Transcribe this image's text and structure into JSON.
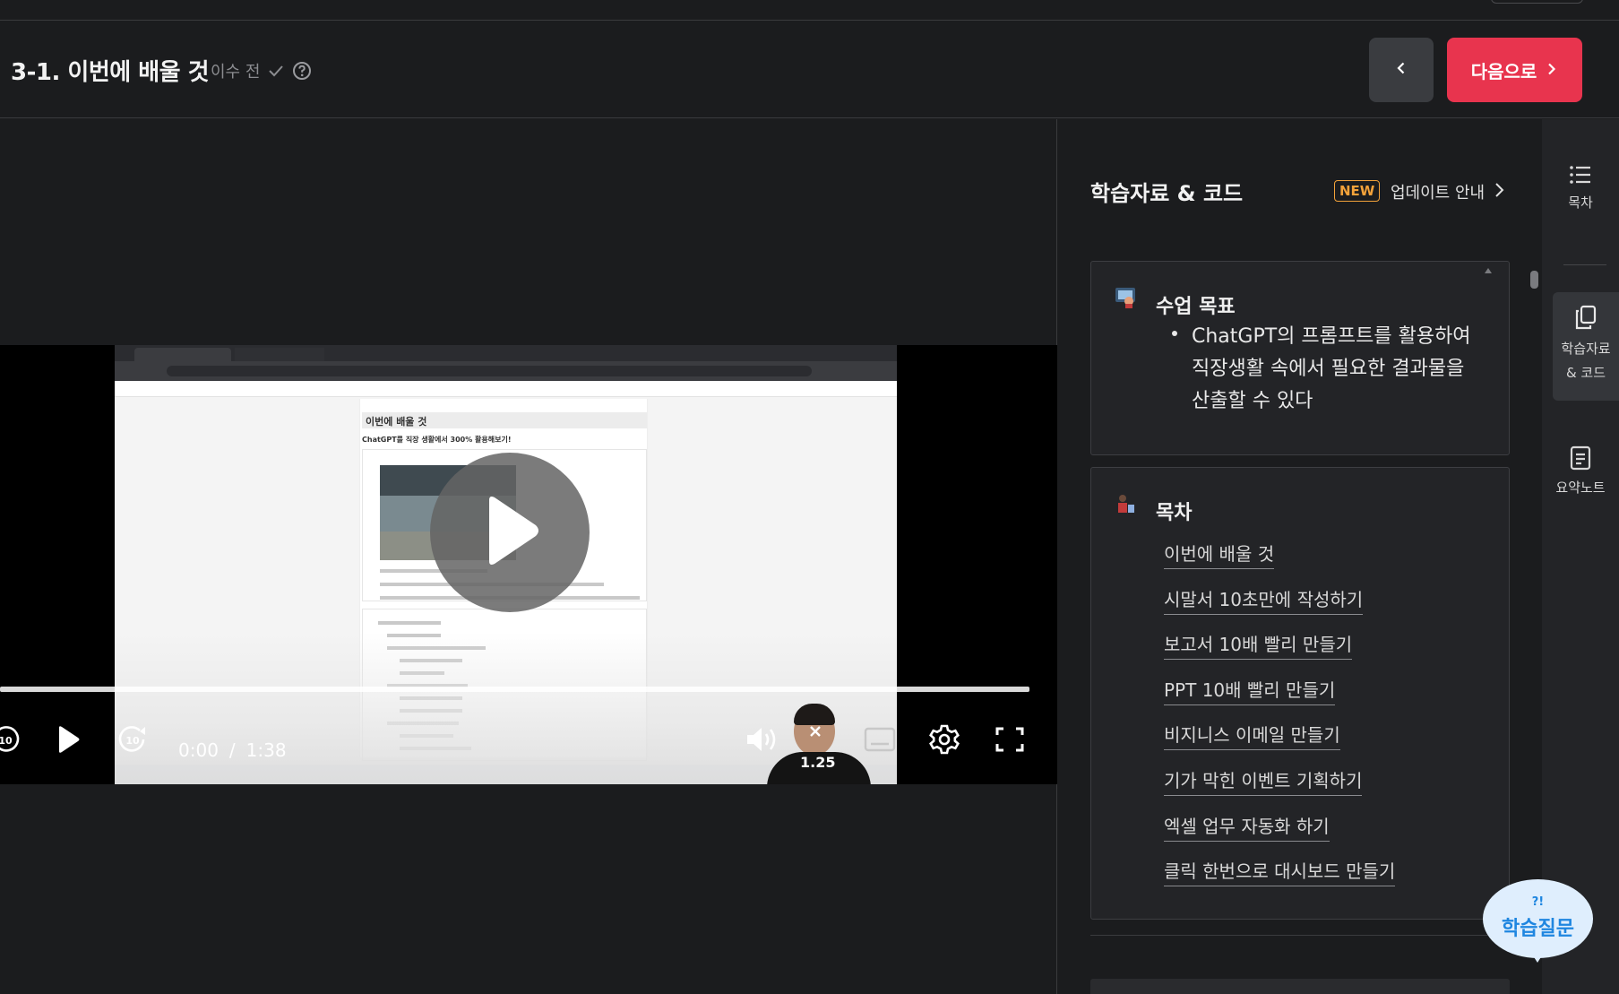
{
  "header": {
    "title": "3-1. 이번에 배울 것",
    "status": "이수 전",
    "next_label": "다음으로"
  },
  "video": {
    "current_time": "0:00",
    "separator": "/",
    "duration": "1:38",
    "speed": "1.25",
    "progress": 0,
    "inner": {
      "heading": "이번에 배울 것",
      "subheading": "ChatGPT를 직장 생활에서 300% 활용해보기!"
    }
  },
  "resources": {
    "title": "학습자료 & 코드",
    "badge": "NEW",
    "update_label": "업데이트 안내",
    "goal": {
      "title": "수업 목표",
      "text": "ChatGPT의 프롬프트를 활용하여 직장생활 속에서 필요한 결과물을 산출할 수 있다"
    },
    "toc": {
      "title": "목차",
      "items": [
        "이번에 배울 것",
        "시말서 10초만에 작성하기",
        "보고서 10배 빨리 만들기",
        "PPT 10배 빨리 만들기",
        "비지니스 이메일 만들기",
        "기가 막힌 이벤트 기획하기",
        "엑셀 업무 자동화 하기",
        "클릭 한번으로 대시보드 만들기"
      ]
    }
  },
  "side_tabs": {
    "toc": "목차",
    "resources_line1": "학습자료",
    "resources_line2": "& 코드",
    "notes": "요약노트"
  },
  "help": {
    "marks": "?!",
    "label": "학습질문"
  },
  "colors": {
    "accent": "#e8344e",
    "badge": "#f3a23a",
    "help": "#1f86e0"
  }
}
